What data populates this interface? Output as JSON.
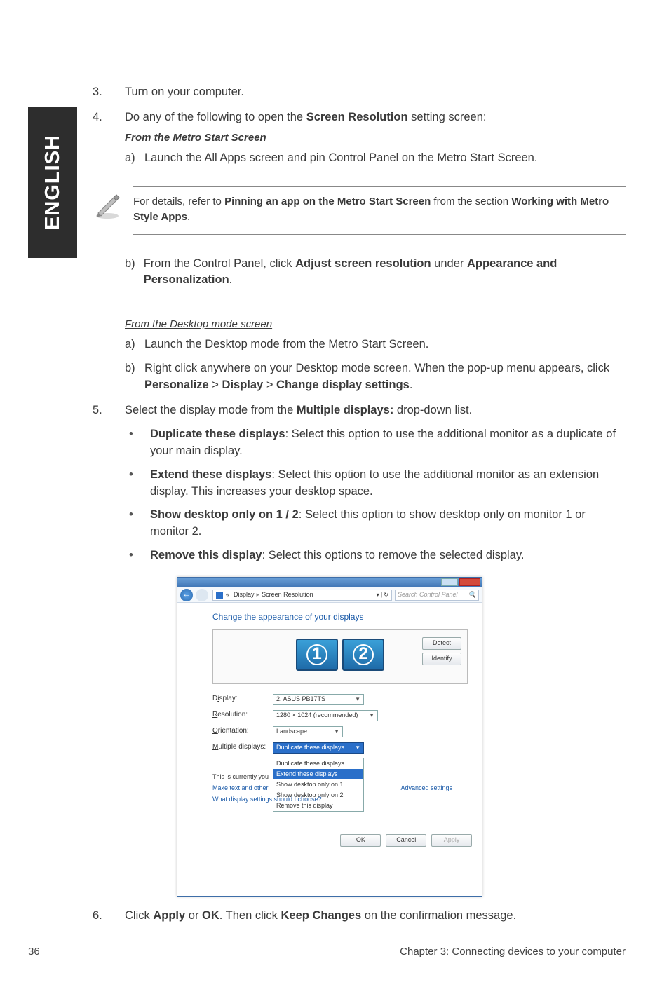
{
  "sideTab": "ENGLISH",
  "steps": {
    "s3": {
      "num": "3.",
      "text": "Turn on your computer."
    },
    "s4": {
      "num": "4.",
      "lead_a": "Do any of the following to open the ",
      "lead_b": "Screen Resolution",
      "lead_c": " setting screen:",
      "sub1_title": "From the Metro Start Screen",
      "a": {
        "lab": "a)",
        "text": "Launch the All Apps screen and pin Control Panel on the Metro Start Screen."
      },
      "note_a": "For details, refer to ",
      "note_b": "Pinning an app on the Metro Start Screen",
      "note_c": " from the section ",
      "note_d": "Working with Metro Style Apps",
      "note_e": ".",
      "b": {
        "lab": "b)",
        "t1": "From the Control Panel, click ",
        "t2": "Adjust screen resolution",
        "t3": " under ",
        "t4": "Appearance and Personalization",
        "t5": "."
      },
      "sub2_title": "From the Desktop mode screen",
      "d_a": {
        "lab": "a)",
        "text": "Launch the Desktop mode from the Metro Start Screen."
      },
      "d_b": {
        "lab": "b)",
        "t1": "Right click anywhere on your Desktop mode screen. When the pop-up menu appears, click ",
        "t2": "Personalize",
        "t3": " > ",
        "t4": "Display",
        "t5": " > ",
        "t6": "Change display settings",
        "t7": "."
      }
    },
    "s5": {
      "num": "5.",
      "lead_a": "Select the display mode from the ",
      "lead_b": "Multiple displays:",
      "lead_c": " drop-down list.",
      "bul1": {
        "b": "Duplicate these displays",
        "t": ": Select this option to use the additional monitor as a duplicate of your main display."
      },
      "bul2": {
        "b": "Extend these displays",
        "t": ": Select this option to use the additional monitor as an extension display. This increases your desktop space."
      },
      "bul3": {
        "b": "Show desktop only on 1 / 2",
        "t": ": Select this option to show desktop only on monitor 1 or monitor 2."
      },
      "bul4": {
        "b": "Remove this display",
        "t": ": Select this options to remove the selected display."
      }
    },
    "s6": {
      "num": "6.",
      "t1": "Click ",
      "t2": "Apply",
      "t3": " or ",
      "t4": "OK",
      "t5": ". Then click ",
      "t6": "Keep Changes",
      "t7": " on the confirmation message."
    }
  },
  "win": {
    "bc1": "Display",
    "bc2": "Screen Resolution",
    "searchPlaceholder": "Search Control Panel",
    "heading": "Change the appearance of your displays",
    "mon1": "1",
    "mon2": "2",
    "btnDetect": "Detect",
    "btnIdentify": "Identify",
    "lblDisplay_pre": "D",
    "lblDisplay_u": "i",
    "lblDisplay_post": "splay:",
    "valDisplay": "2. ASUS PB17TS",
    "lblRes_u": "R",
    "lblRes_post": "esolution:",
    "valRes": "1280 × 1024 (recommended)",
    "lblOri_u": "O",
    "lblOri_post": "rientation:",
    "valOri": "Landscape",
    "lblMulti_u": "M",
    "lblMulti_post": "ultiple displays:",
    "valMulti": "Duplicate these displays",
    "dd1": "Duplicate these displays",
    "dd2": "Extend these displays",
    "dd3": "Show desktop only on 1",
    "dd4": "Show desktop only on 2",
    "dd5": "Remove this display",
    "note1_a": "This is currently you",
    "link1": "Make text and other",
    "link2": "What display settings should I choose?",
    "adv": "Advanced settings",
    "btnOK": "OK",
    "btnCancel": "Cancel",
    "btnApply": "Apply"
  },
  "footer": {
    "page": "36",
    "chapter": "Chapter 3: Connecting devices to your computer"
  }
}
